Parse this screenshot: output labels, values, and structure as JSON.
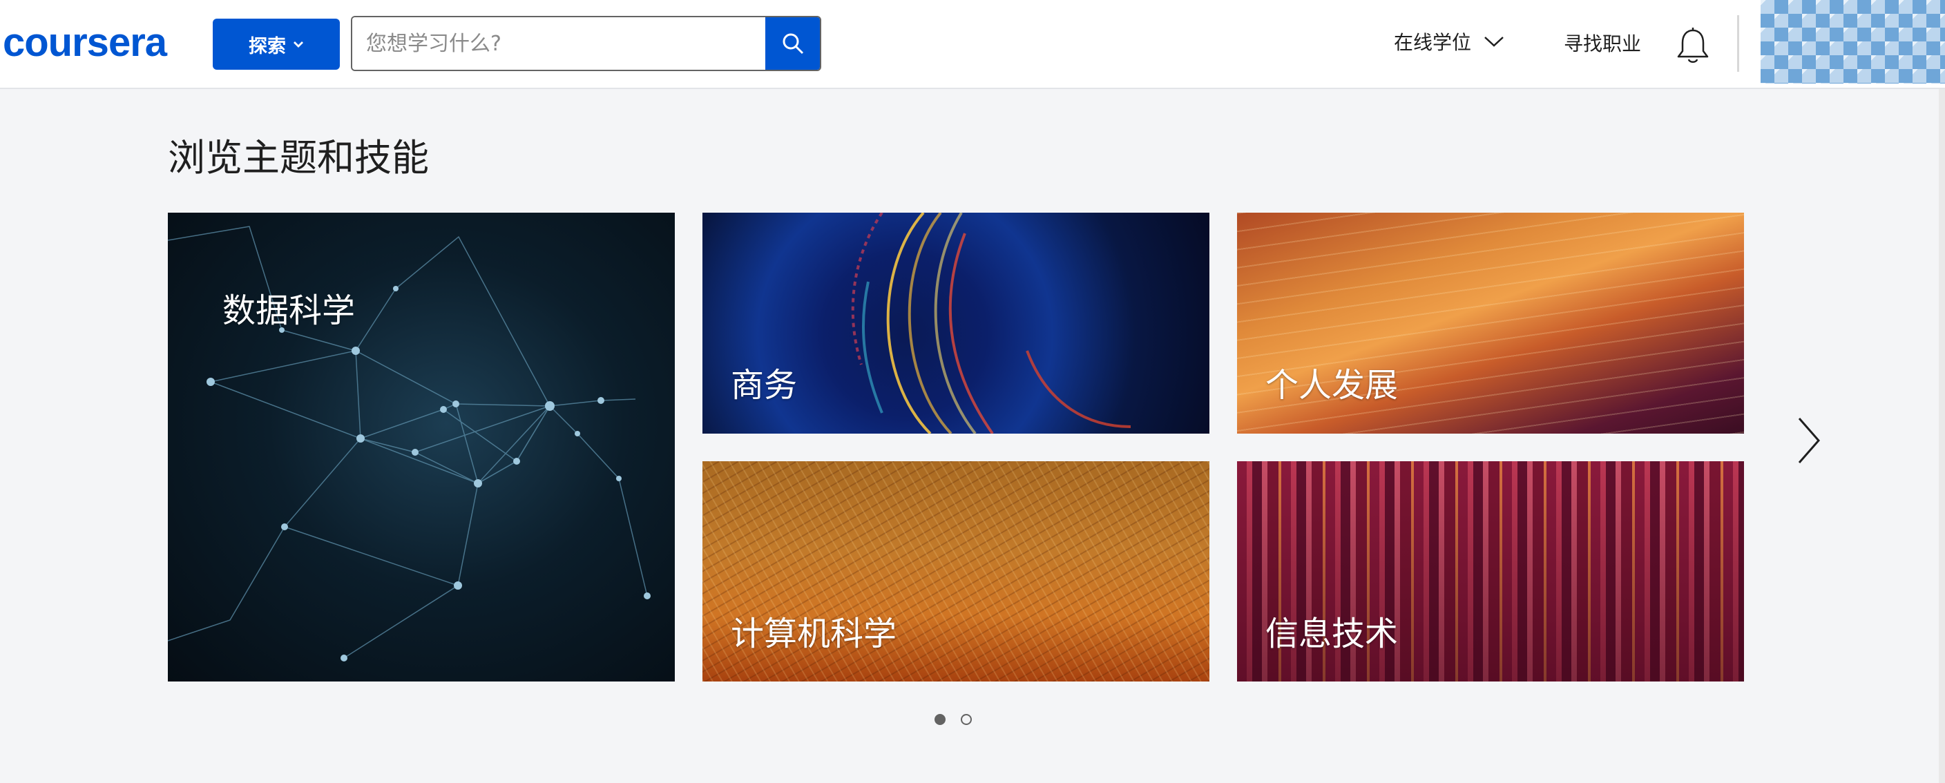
{
  "header": {
    "logo_text": "coursera",
    "explore_label": "探索",
    "search_placeholder": "您想学习什么?",
    "nav_degree": "在线学位",
    "nav_career": "寻找职业"
  },
  "main": {
    "section_title": "浏览主题和技能",
    "tiles": [
      {
        "label": "数据科学"
      },
      {
        "label": "商务"
      },
      {
        "label": "个人发展"
      },
      {
        "label": "计算机科学"
      },
      {
        "label": "信息技术"
      }
    ]
  },
  "pagination": {
    "current": 1,
    "total": 2
  },
  "colors": {
    "brand": "#0056d2",
    "text": "#1f1f1f",
    "background": "#f4f5f7"
  }
}
